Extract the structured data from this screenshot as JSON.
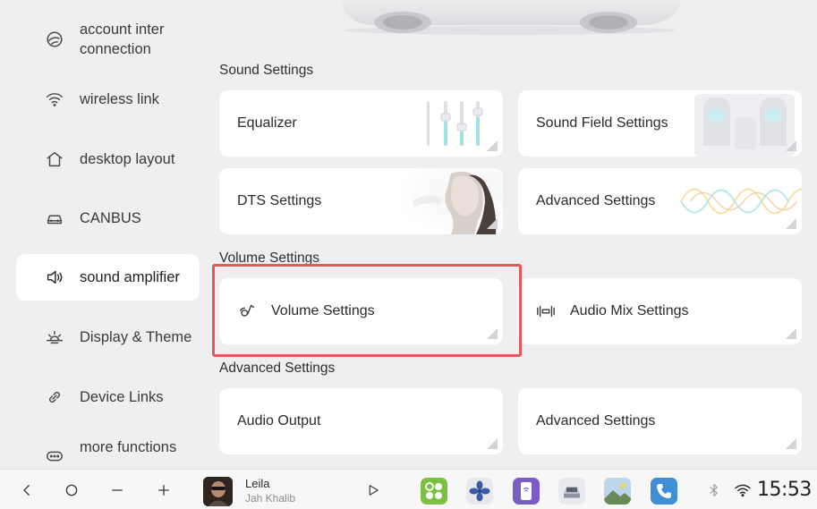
{
  "sidebar": {
    "items": [
      {
        "label": "account inter connection",
        "icon": "account-link-icon"
      },
      {
        "label": "wireless link",
        "icon": "wifi-icon"
      },
      {
        "label": "desktop layout",
        "icon": "home-icon"
      },
      {
        "label": "CANBUS",
        "icon": "car-icon"
      },
      {
        "label": "sound amplifier",
        "icon": "speaker-icon",
        "active": true
      },
      {
        "label": "Display & Theme",
        "icon": "sun-icon"
      },
      {
        "label": "Device Links",
        "icon": "link-icon"
      },
      {
        "label": "more functions",
        "icon": "more-icon"
      }
    ]
  },
  "sections": {
    "sound": {
      "title": "Sound Settings",
      "cards": [
        "Equalizer",
        "Sound Field Settings",
        "DTS Settings",
        "Advanced Settings"
      ]
    },
    "volume": {
      "title": "Volume Settings",
      "cards": [
        "Volume Settings",
        "Audio Mix Settings"
      ]
    },
    "advanced": {
      "title": "Advanced Settings",
      "cards": [
        "Audio Output",
        "Advanced Settings"
      ]
    }
  },
  "media": {
    "title": "Leila",
    "artist": "Jah Khalib"
  },
  "status": {
    "time": "15:53"
  },
  "colors": {
    "highlight": "#e8555a",
    "active_bg": "#ffffff",
    "background": "#efeff0"
  }
}
